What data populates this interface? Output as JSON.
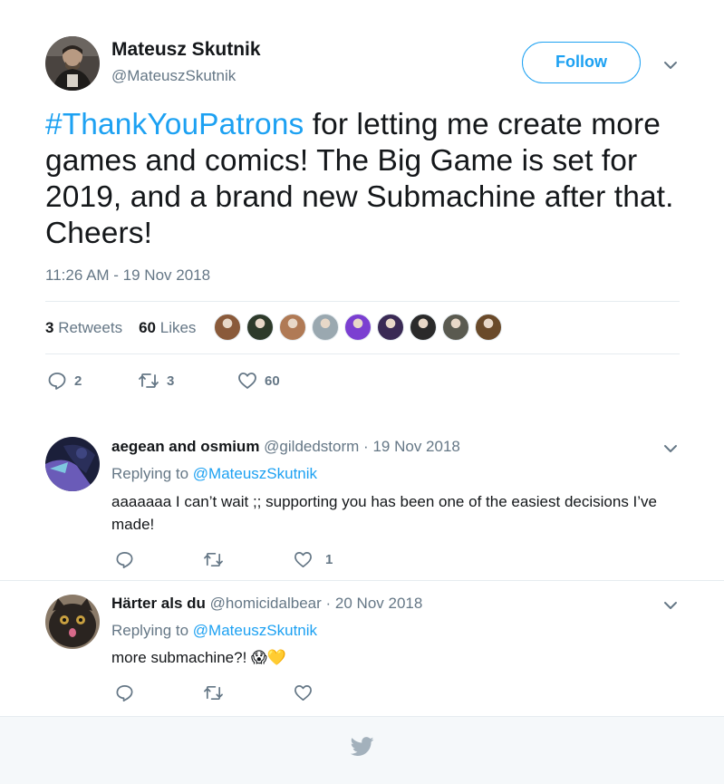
{
  "tweet": {
    "author_name": "Mateusz Skutnik",
    "author_handle": "@MateuszSkutnik",
    "follow_label": "Follow",
    "hashtag": "#ThankYouPatrons",
    "text": " for letting me create more games and comics! The Big Game is set for 2019, and a brand new Submachine after that. Cheers!",
    "timestamp": "11:26 AM - 19 Nov 2018",
    "retweets_count": "3",
    "retweets_label": "Retweets",
    "likes_count": "60",
    "likes_label": "Likes",
    "actions": {
      "replies": "2",
      "retweets": "3",
      "likes": "60"
    },
    "likers": [
      {
        "icon": "liker-avatar-1",
        "color": "#8a5a3a"
      },
      {
        "icon": "liker-avatar-2",
        "color": "#2d3a2a"
      },
      {
        "icon": "liker-avatar-3",
        "color": "#b07a55"
      },
      {
        "icon": "liker-avatar-4",
        "color": "#9aa8b0"
      },
      {
        "icon": "liker-avatar-5",
        "color": "#7b3fd1"
      },
      {
        "icon": "liker-avatar-6",
        "color": "#3a2a55"
      },
      {
        "icon": "liker-avatar-7",
        "color": "#2a2a2a"
      },
      {
        "icon": "liker-avatar-8",
        "color": "#5a5a50"
      },
      {
        "icon": "liker-avatar-9",
        "color": "#6a4a2a"
      }
    ]
  },
  "replies": [
    {
      "name": "aegean and osmium",
      "handle": "@gildedstorm",
      "date": "19 Nov 2018",
      "replying_prefix": "Replying to ",
      "replying_to": "@MateuszSkutnik",
      "text": "aaaaaaa I can’t wait ;; supporting you has been one of the easiest decisions I’ve made!",
      "likes": "1"
    },
    {
      "name": "Härter als du",
      "handle": "@homicidalbear",
      "date": "20 Nov 2018",
      "replying_prefix": "Replying to ",
      "replying_to": "@MateuszSkutnik",
      "text": "more submachine?! 😱💛",
      "likes": ""
    }
  ],
  "colors": {
    "accent": "#1da1f2",
    "secondary_text": "#657786",
    "divider": "#e6ecf0",
    "footer_bg": "#f5f8fa"
  }
}
